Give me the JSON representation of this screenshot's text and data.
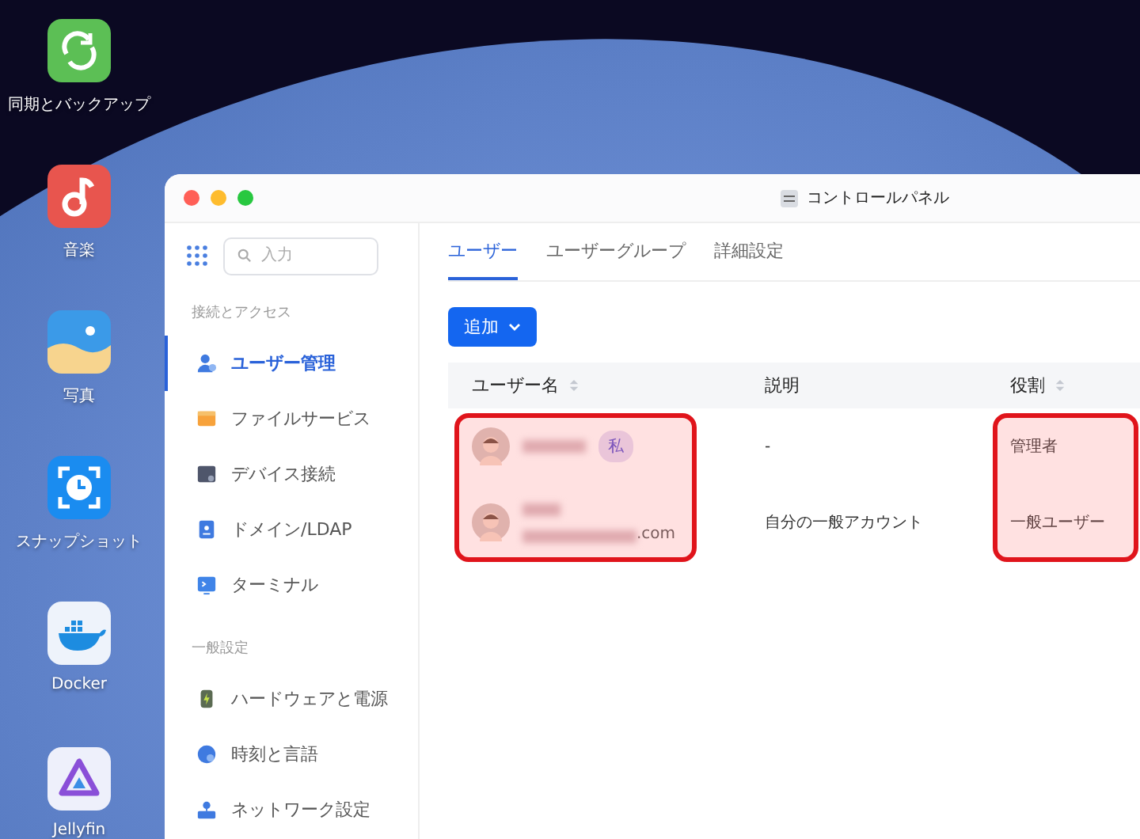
{
  "desktop_apps": [
    {
      "label": "同期とバックアップ",
      "kind": "sync"
    },
    {
      "label": "音楽",
      "kind": "music"
    },
    {
      "label": "写真",
      "kind": "photos"
    },
    {
      "label": "スナップショット",
      "kind": "snapshot"
    },
    {
      "label": "Docker",
      "kind": "docker"
    },
    {
      "label": "Jellyfin",
      "kind": "jellyfin"
    }
  ],
  "window": {
    "title": "コントロールパネル"
  },
  "sidebar": {
    "search": {
      "placeholder": "入力"
    },
    "sections": [
      {
        "title": "接続とアクセス",
        "items": [
          {
            "label": "ユーザー管理",
            "kind": "user",
            "selected": true
          },
          {
            "label": "ファイルサービス",
            "kind": "folder",
            "selected": false
          },
          {
            "label": "デバイス接続",
            "kind": "device",
            "selected": false
          },
          {
            "label": "ドメイン/LDAP",
            "kind": "domain",
            "selected": false
          },
          {
            "label": "ターミナル",
            "kind": "terminal",
            "selected": false
          }
        ]
      },
      {
        "title": "一般設定",
        "items": [
          {
            "label": "ハードウェアと電源",
            "kind": "battery",
            "selected": false
          },
          {
            "label": "時刻と言語",
            "kind": "globe",
            "selected": false
          },
          {
            "label": "ネットワーク設定",
            "kind": "network",
            "selected": false
          }
        ]
      }
    ]
  },
  "tabs": [
    {
      "label": "ユーザー",
      "selected": true
    },
    {
      "label": "ユーザーグループ",
      "selected": false
    },
    {
      "label": "詳細設定",
      "selected": false
    }
  ],
  "add_button": {
    "label": "追加"
  },
  "table": {
    "columns": [
      {
        "label": "ユーザー名",
        "sortable": true,
        "highlighted": true
      },
      {
        "label": "説明",
        "sortable": false,
        "highlighted": false
      },
      {
        "label": "役割",
        "sortable": true,
        "highlighted": true
      }
    ],
    "rows": [
      {
        "kind": "self",
        "badge": "私",
        "description": "-",
        "role": "管理者"
      },
      {
        "kind": "email",
        "email_suffix": ".com",
        "description": "自分の一般アカウント",
        "role": "一般ユーザー"
      }
    ]
  }
}
